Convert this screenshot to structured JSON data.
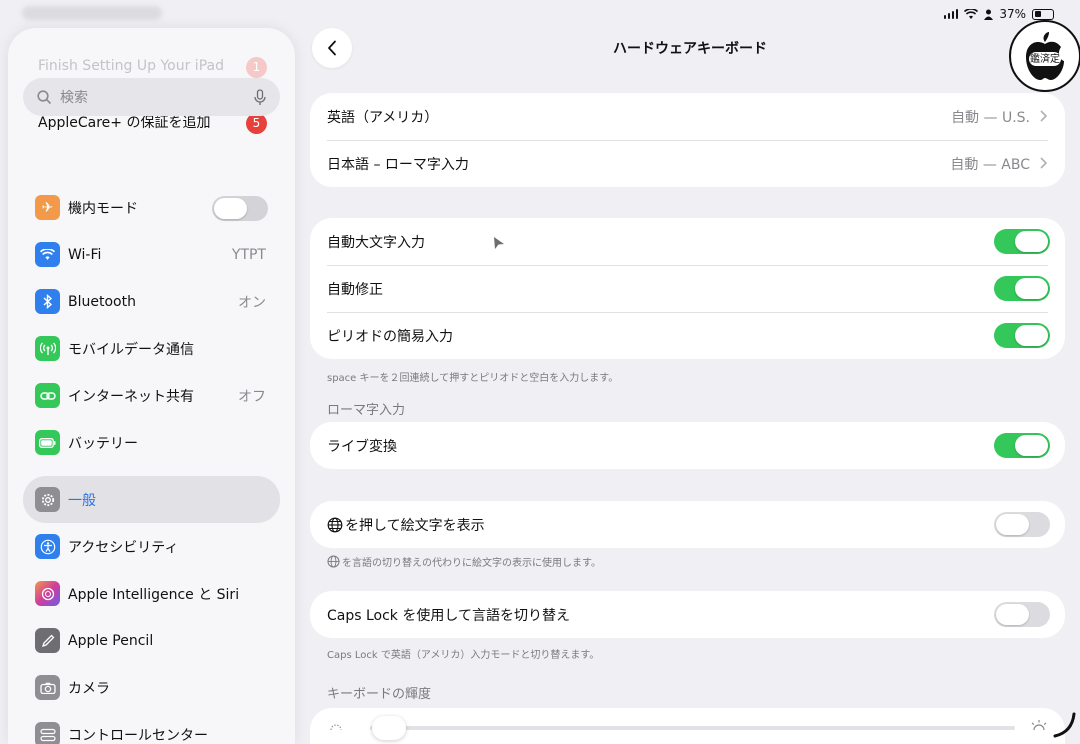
{
  "status": {
    "battery": "37%"
  },
  "sidebar": {
    "setup": {
      "label": "Finish Setting Up Your iPad",
      "badge": "1"
    },
    "search": {
      "placeholder": "検索"
    },
    "applecare": {
      "label": "AppleCare+ の保証を追加",
      "badge": "5"
    },
    "items": [
      {
        "label": "機内モード",
        "icon": "airplane-icon",
        "color": "#f2994a",
        "value": ""
      },
      {
        "label": "Wi-Fi",
        "icon": "wifi-icon",
        "color": "#2f80ed",
        "value": "YTPT"
      },
      {
        "label": "Bluetooth",
        "icon": "bluetooth-icon",
        "color": "#2f80ed",
        "value": "オン"
      },
      {
        "label": "モバイルデータ通信",
        "icon": "antenna-icon",
        "color": "#34c759",
        "value": ""
      },
      {
        "label": "インターネット共有",
        "icon": "link-icon",
        "color": "#34c759",
        "value": "オフ"
      },
      {
        "label": "バッテリー",
        "icon": "battery-icon",
        "color": "#34c759",
        "value": ""
      },
      {
        "label": "一般",
        "icon": "gear-icon",
        "color": "#8e8e93",
        "value": ""
      },
      {
        "label": "アクセシビリティ",
        "icon": "accessibility-icon",
        "color": "#2f80ed",
        "value": ""
      },
      {
        "label": "Apple Intelligence と Siri",
        "icon": "siri-icon",
        "color": "#b36bd6",
        "value": ""
      },
      {
        "label": "Apple Pencil",
        "icon": "pencil-icon",
        "color": "#6d6d72",
        "value": ""
      },
      {
        "label": "カメラ",
        "icon": "camera-icon",
        "color": "#8e8e93",
        "value": ""
      },
      {
        "label": "コントロールセンター",
        "icon": "control-center-icon",
        "color": "#8e8e93",
        "value": ""
      }
    ]
  },
  "main": {
    "title": "ハードウェアキーボード",
    "keyboards": [
      {
        "label": "英語（アメリカ）",
        "detail": "自動 — U.S."
      },
      {
        "label": "日本語 – ローマ字入力",
        "detail": "自動 — ABC"
      }
    ],
    "auto_caps": "自動大文字入力",
    "auto_correct": "自動修正",
    "period": "ピリオドの簡易入力",
    "period_note": "space キーを２回連続して押すとピリオドと空白を入力します。",
    "romaji_header": "ローマ字入力",
    "live_convert": "ライブ変換",
    "globe_emoji": "を押して絵文字を表示",
    "globe_note": "を言語の切り替えの代わりに絵文字の表示に使用します。",
    "caps_lock": "Caps Lock を使用して言語を切り替え",
    "caps_note": "Caps Lock で英語（アメリカ）入力モードと切り替えます。",
    "brightness_header": "キーボードの輝度",
    "brightness_level": 0.03
  },
  "logo": {
    "text": "鑑済定"
  }
}
